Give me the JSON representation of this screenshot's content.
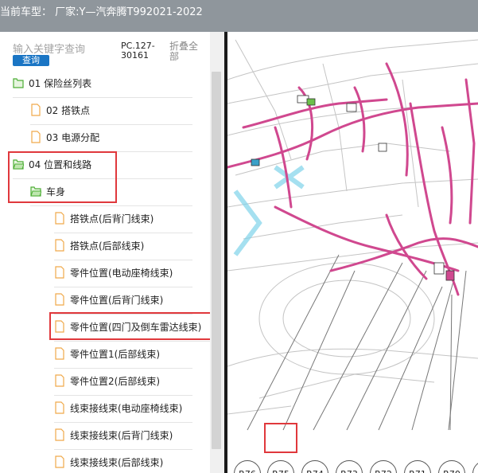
{
  "title": "当前车型： 厂家:Y—汽奔腾T992021-2022",
  "search": {
    "placeholder": "输入关键字查询",
    "button": "查询"
  },
  "pc_code": "PC.127-30161",
  "collapse_all": "折叠全部",
  "tree": [
    {
      "label": "01 保险丝列表",
      "icon": "folder-icon"
    },
    {
      "label": "02 搭铁点",
      "icon": "document-icon"
    },
    {
      "label": "03 电源分配",
      "icon": "document-icon"
    },
    {
      "label": "04 位置和线路",
      "icon": "folder-icon"
    },
    {
      "label": "车身",
      "icon": "folder-icon"
    },
    {
      "label": "搭铁点(后背门线束)",
      "icon": "document-icon"
    },
    {
      "label": "搭铁点(后部线束)",
      "icon": "document-icon"
    },
    {
      "label": "零件位置(电动座椅线束)",
      "icon": "document-icon"
    },
    {
      "label": "零件位置(后背门线束)",
      "icon": "document-icon"
    },
    {
      "label": "零件位置(四门及倒车雷达线束)",
      "icon": "document-icon"
    },
    {
      "label": "零件位置1(后部线束)",
      "icon": "document-icon"
    },
    {
      "label": "零件位置2(后部线束)",
      "icon": "document-icon"
    },
    {
      "label": "线束接线束(电动座椅线束)",
      "icon": "document-icon"
    },
    {
      "label": "线束接线束(后背门线束)",
      "icon": "document-icon"
    },
    {
      "label": "线束接线束(后部线束)",
      "icon": "document-icon"
    }
  ],
  "connector_labels": [
    "R76",
    "R75",
    "R74",
    "R73",
    "R72",
    "R71",
    "R70"
  ],
  "colors": {
    "harness": "#d0488f",
    "highlight": "#e0383c",
    "folder": "#4cae35",
    "document": "#f0a94a",
    "button": "#1a75c4"
  }
}
